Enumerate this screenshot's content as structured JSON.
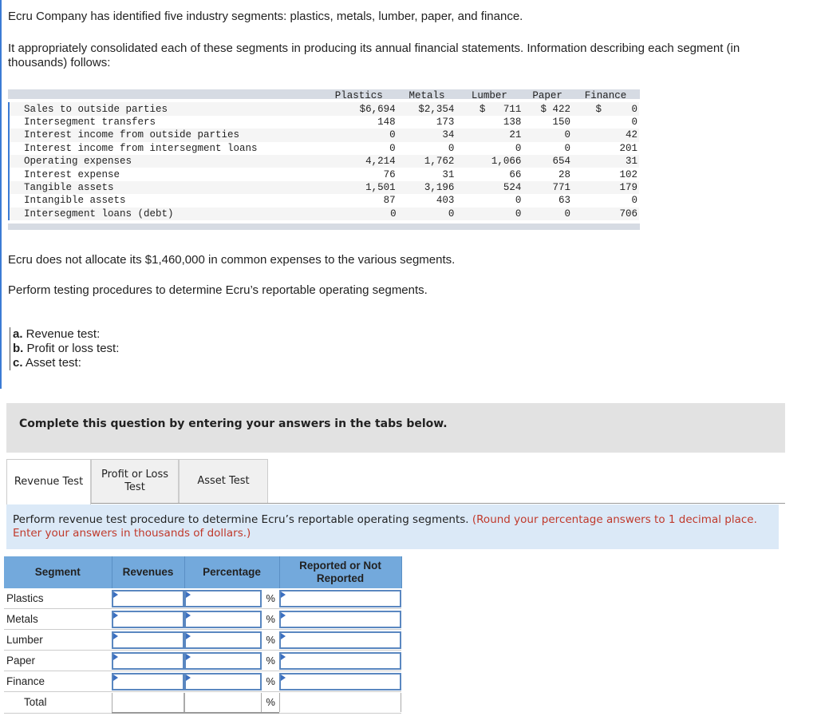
{
  "intro": {
    "p1": "Ecru Company has identified five industry segments: plastics, metals, lumber, paper, and finance.",
    "p2": "It appropriately consolidated each of these segments in producing its annual financial statements. Information describing each segment (in thousands) follows:",
    "p3": "Ecru does not allocate its $1,460,000 in common expenses to the various segments.",
    "p4": "Perform testing procedures to determine Ecru’s reportable operating segments."
  },
  "segment_table": {
    "columns": [
      "Plastics",
      "Metals",
      "Lumber",
      "Paper",
      "Finance"
    ],
    "rows": [
      {
        "label": "Sales to outside parties",
        "values": [
          "$6,694",
          "$2,354",
          "$   711",
          "$ 422",
          "$     0"
        ]
      },
      {
        "label": "Intersegment transfers",
        "values": [
          "148",
          "173",
          "138",
          "150",
          "0"
        ]
      },
      {
        "label": "Interest income from outside parties",
        "values": [
          "0",
          "34",
          "21",
          "0",
          "42"
        ]
      },
      {
        "label": "Interest income from intersegment loans",
        "values": [
          "0",
          "0",
          "0",
          "0",
          "201"
        ]
      },
      {
        "label": "Operating expenses",
        "values": [
          "4,214",
          "1,762",
          "1,066",
          "654",
          "31"
        ]
      },
      {
        "label": "Interest expense",
        "values": [
          "76",
          "31",
          "66",
          "28",
          "102"
        ]
      },
      {
        "label": "Tangible assets",
        "values": [
          "1,501",
          "3,196",
          "524",
          "771",
          "179"
        ]
      },
      {
        "label": "Intangible assets",
        "values": [
          "87",
          "403",
          "0",
          "63",
          "0"
        ]
      },
      {
        "label": "Intersegment loans (debt)",
        "values": [
          "0",
          "0",
          "0",
          "0",
          "706"
        ]
      }
    ]
  },
  "parts": [
    {
      "letter": "a.",
      "text": " Revenue test:"
    },
    {
      "letter": "b.",
      "text": " Profit or loss test:"
    },
    {
      "letter": "c.",
      "text": " Asset test:"
    }
  ],
  "banner": "Complete this question by entering your answers in the tabs below.",
  "tabs": [
    {
      "label": "Revenue Test",
      "active": true
    },
    {
      "label": "Profit or Loss Test",
      "active": false
    },
    {
      "label": "Asset Test",
      "active": false
    }
  ],
  "instruction": {
    "text": "Perform revenue test procedure to determine Ecru’s reportable operating segments. ",
    "note": "(Round your percentage answers to 1 decimal place. Enter your answers in thousands of dollars.)"
  },
  "answer_table": {
    "headers": [
      "Segment",
      "Revenues",
      "Percentage",
      "Reported or Not Reported"
    ],
    "percent_symbol": "%",
    "rows": [
      "Plastics",
      "Metals",
      "Lumber",
      "Paper",
      "Finance"
    ],
    "total_label": "Total"
  }
}
